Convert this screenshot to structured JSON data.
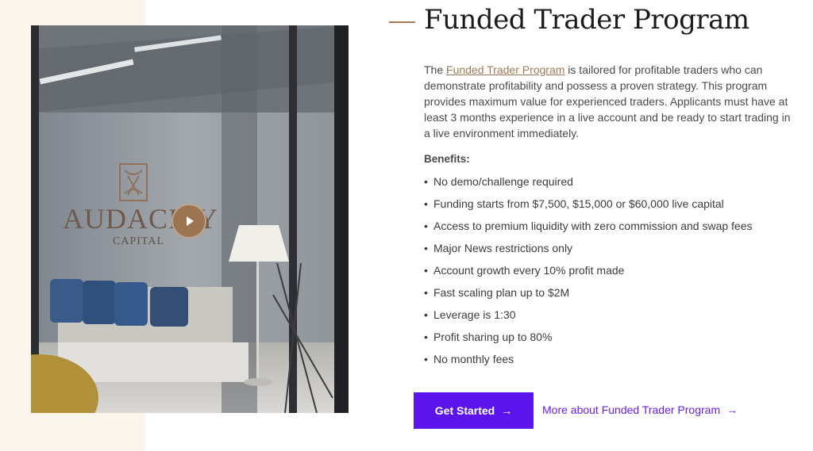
{
  "hero": {
    "title": "Funded Trader Program",
    "intro_prefix": "The ",
    "intro_link": "Funded Trader Program",
    "intro_rest": " is tailored for profitable traders who can demonstrate profitability and possess a proven strategy. This program provides maximum value for experienced traders. Applicants must have at least 3 months experience in a live account and be ready to start trading in a live environment immediately."
  },
  "video": {
    "brand": "AUDACITY",
    "brand_sub": "CAPITAL",
    "play_icon": "play-icon"
  },
  "benefits": {
    "heading": "Benefits:",
    "items": [
      "No demo/challenge required",
      "Funding starts from $7,500, $15,000 or $60,000 live capital",
      "Access to premium liquidity with zero commission and swap fees",
      "Major News restrictions only",
      "Account growth every 10% profit made",
      "Fast scaling plan up to $2M",
      "Leverage is 1:30",
      "Profit sharing up to 80%",
      "No monthly fees"
    ]
  },
  "actions": {
    "get_started": "Get Started",
    "more": "More about Funded Trader Program",
    "arrow": "→"
  },
  "colors": {
    "accent_brown": "#a07a57",
    "primary_purple": "#5b14ec",
    "link_purple": "#6a1cf0",
    "left_panel": "#fcf5ec"
  }
}
